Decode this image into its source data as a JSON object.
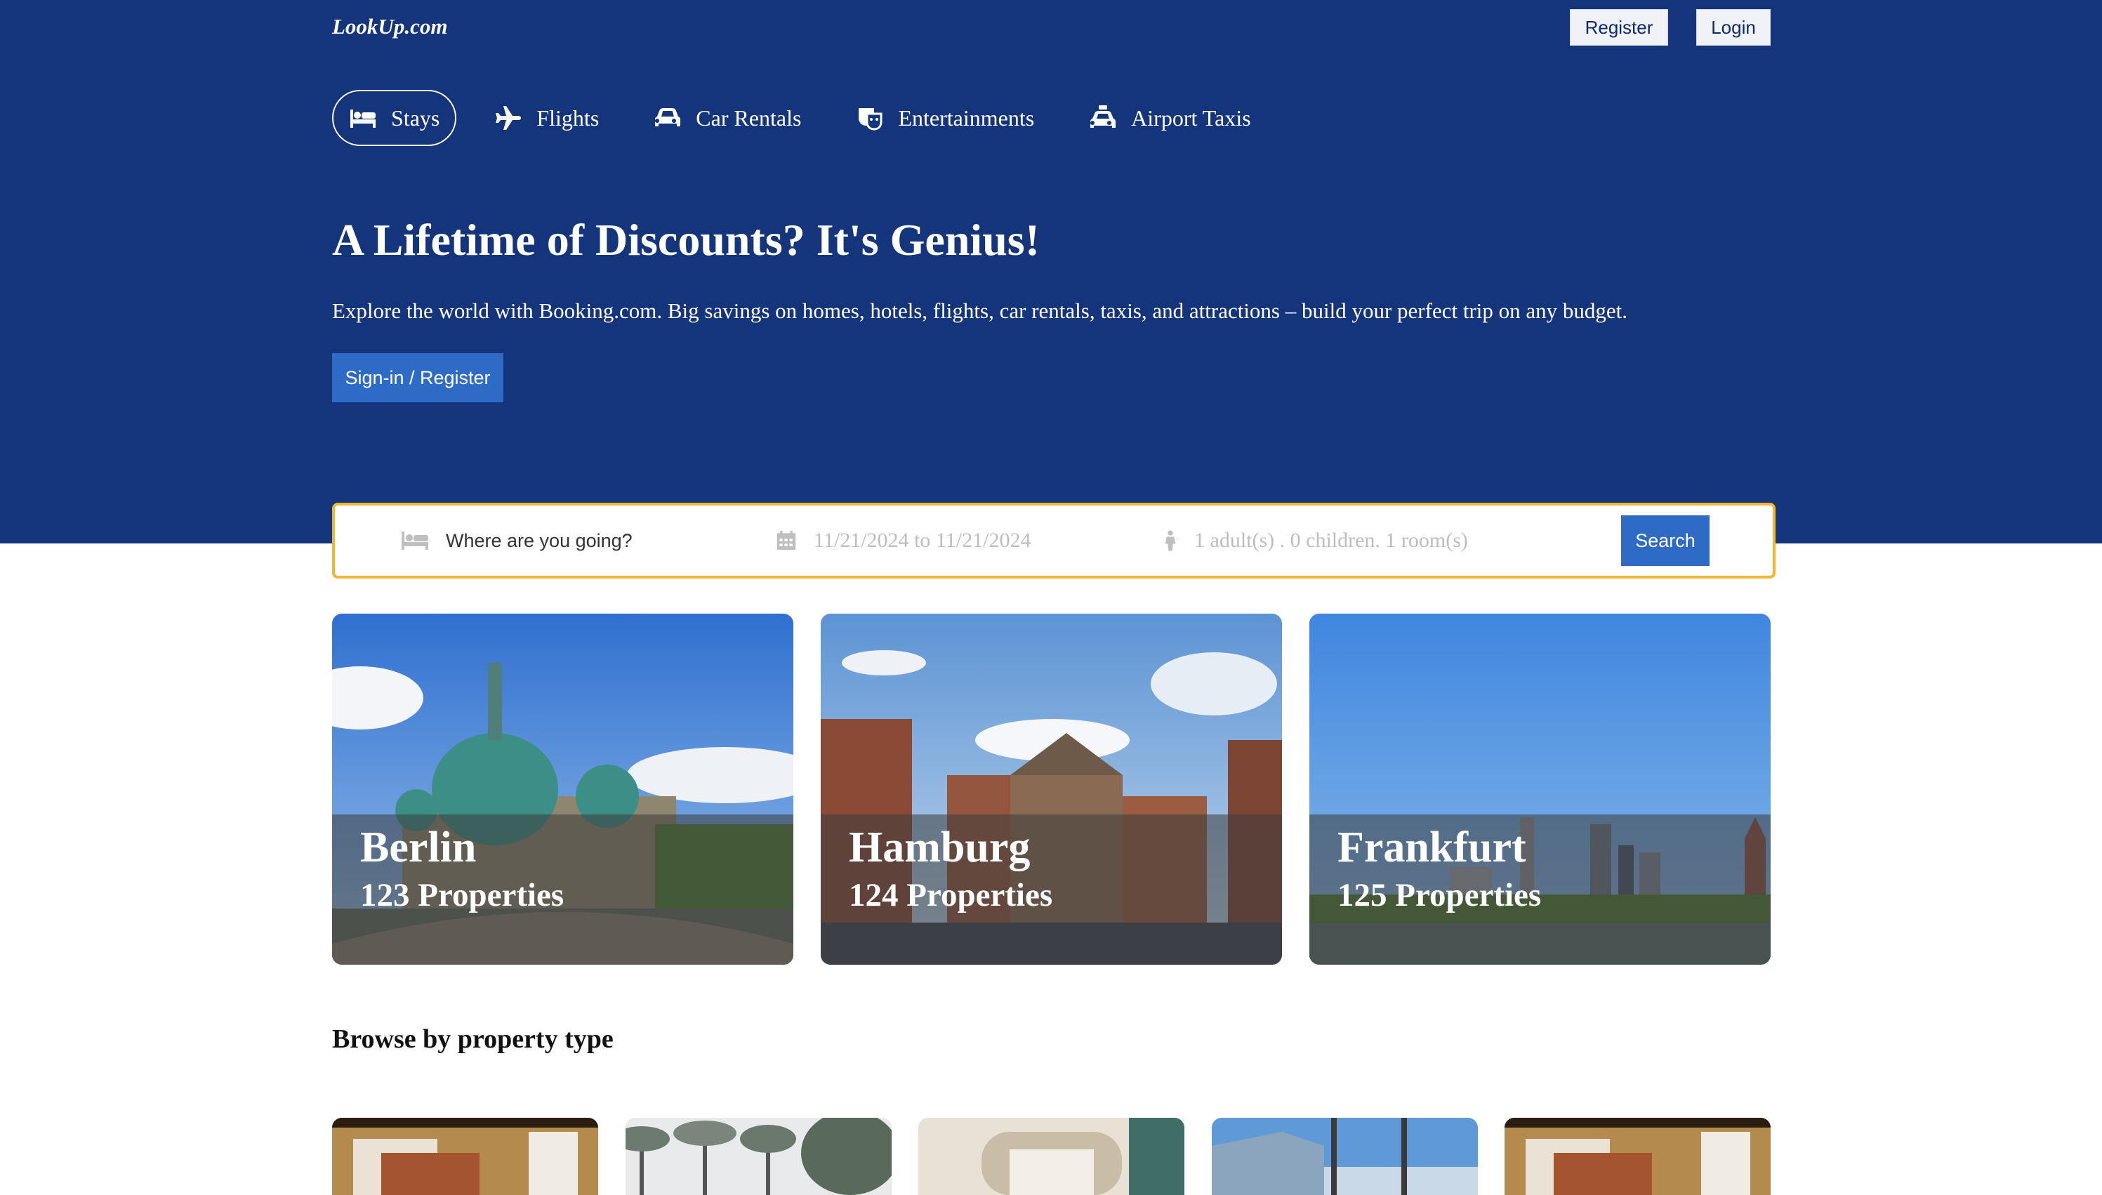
{
  "header": {
    "logo": "LookUp.com",
    "register_label": "Register",
    "login_label": "Login"
  },
  "nav": {
    "items": [
      {
        "label": "Stays",
        "icon": "bed-icon",
        "active": true
      },
      {
        "label": "Flights",
        "icon": "plane-icon",
        "active": false
      },
      {
        "label": "Car Rentals",
        "icon": "car-icon",
        "active": false
      },
      {
        "label": "Entertainments",
        "icon": "entertainment-icon",
        "active": false
      },
      {
        "label": "Airport Taxis",
        "icon": "taxi-icon",
        "active": false
      }
    ]
  },
  "hero": {
    "headline": "A Lifetime of Discounts? It's Genius!",
    "subtext": "Explore the world with Booking.com. Big savings on homes, hotels, flights, car rentals, taxis, and attractions – build your perfect trip on any budget.",
    "signin_label": "Sign-in / Register"
  },
  "search": {
    "destination_placeholder": "Where are you going?",
    "destination_value": "",
    "dates": "11/21/2024 to 11/21/2024",
    "guests": "1 adult(s) . 0 children. 1 room(s)",
    "button_label": "Search",
    "icons": [
      "bed-icon",
      "calendar-icon",
      "person-icon"
    ]
  },
  "cities": [
    {
      "name": "Berlin",
      "count": "123 Properties"
    },
    {
      "name": "Hamburg",
      "count": "124 Properties"
    },
    {
      "name": "Frankfurt",
      "count": "125 Properties"
    }
  ],
  "property_section": {
    "title": "Browse by property type",
    "cards": 5
  },
  "colors": {
    "hero_bg": "#14347c",
    "primary_button": "#2e6bc6",
    "search_border": "#f3b532"
  }
}
